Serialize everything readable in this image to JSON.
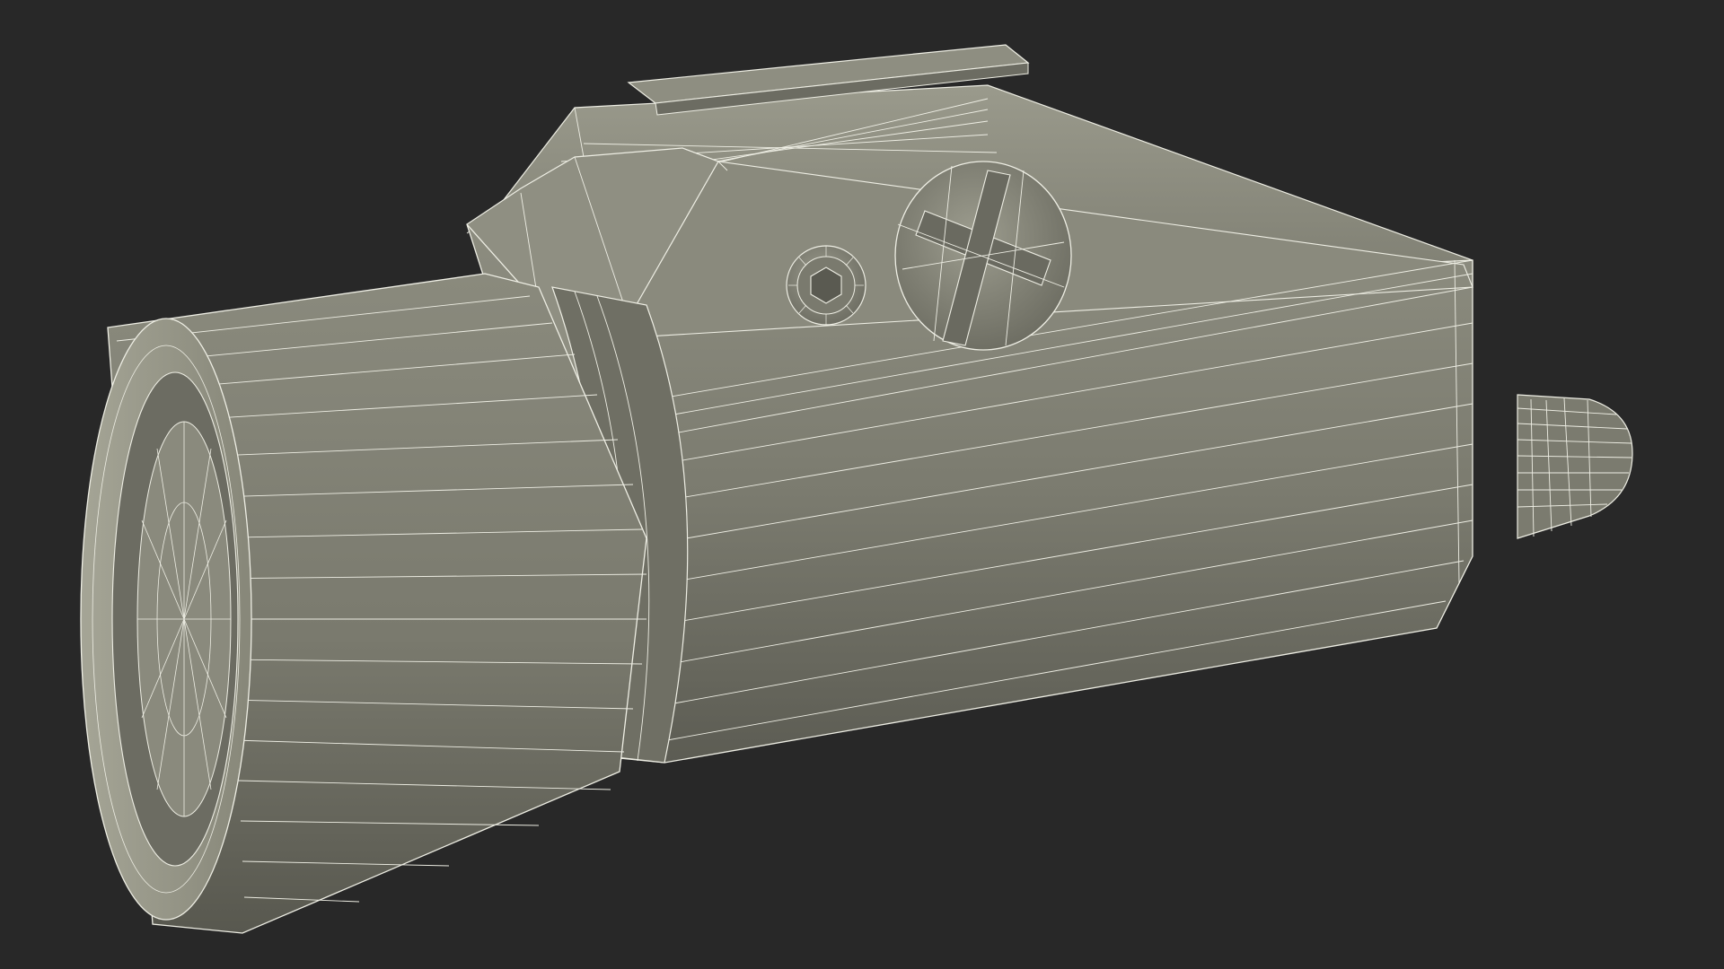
{
  "scene": {
    "subject": "weapon-light-wireframe-render",
    "background_color": "#282828",
    "surface_color": "#7d7d70",
    "surface_shadow_color": "#5f5f55",
    "surface_highlight_color": "#a3a394",
    "wire_color": "#eeeee4",
    "icons": [
      "hex-screw-icon",
      "slotted-knob-icon"
    ]
  }
}
